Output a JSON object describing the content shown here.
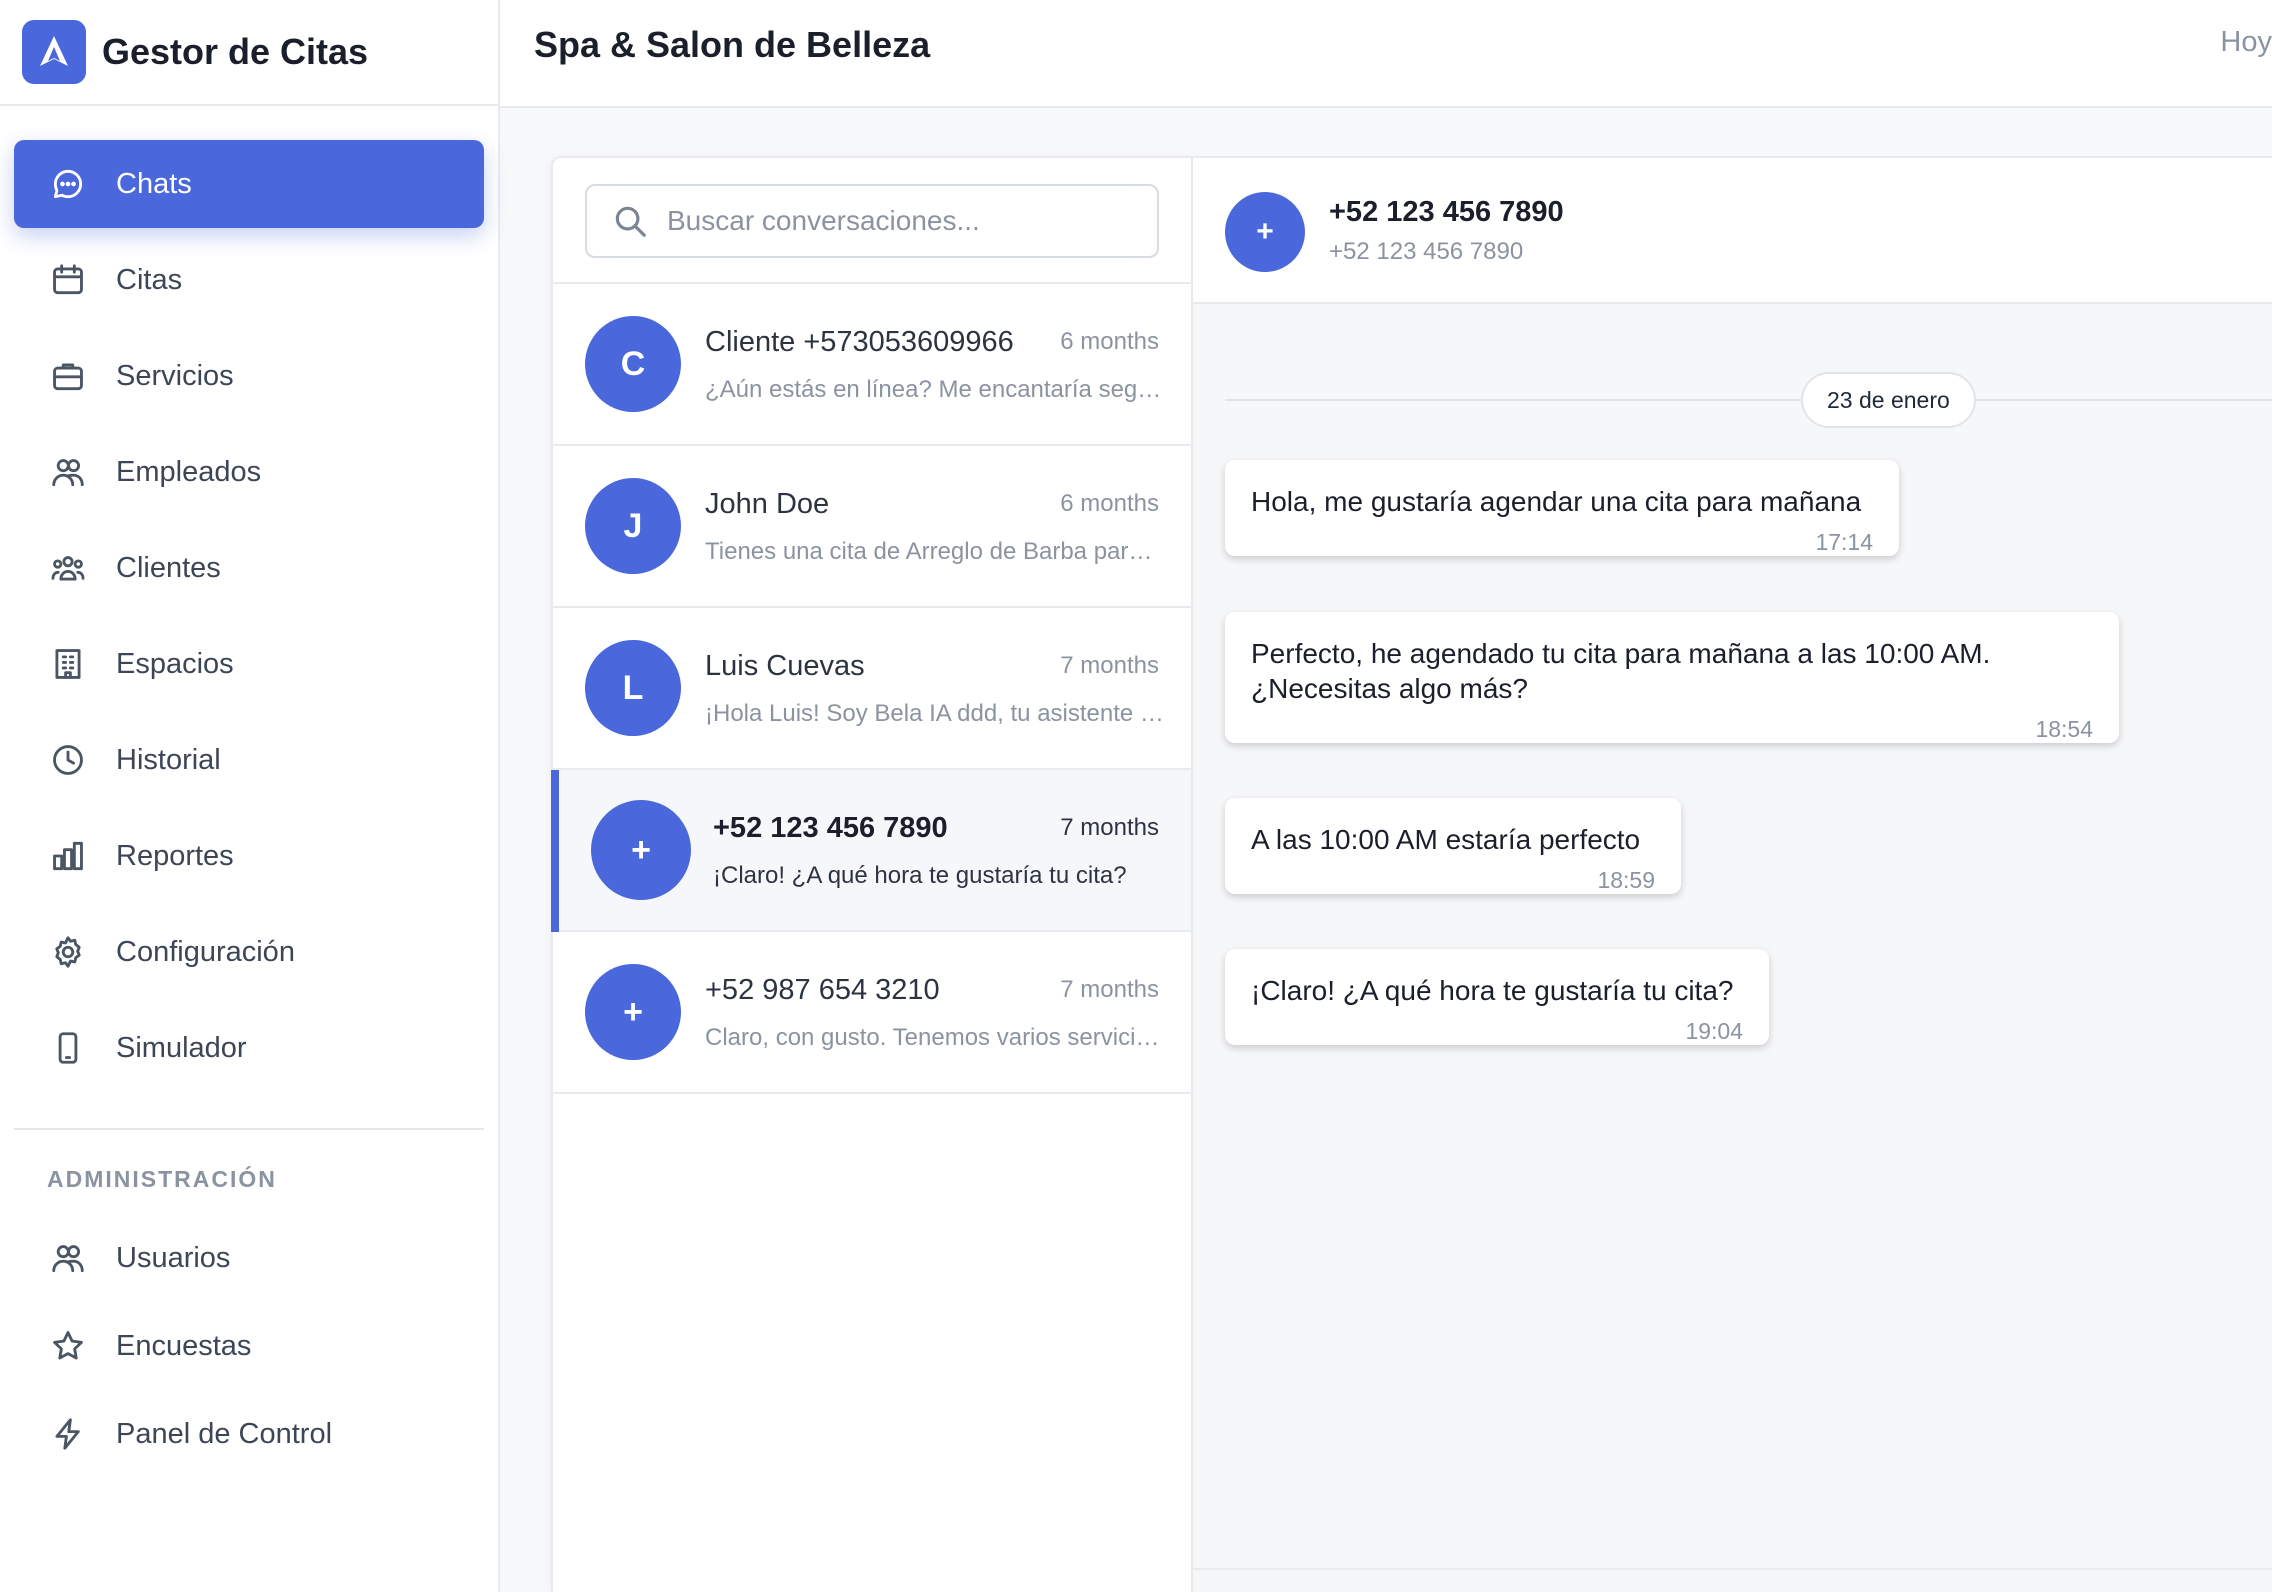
{
  "app": {
    "title": "Gestor de Citas"
  },
  "header": {
    "title": "Spa & Salon de Belleza",
    "right_text": "Hoy"
  },
  "sidebar": {
    "items": [
      {
        "label": "Chats",
        "icon": "chat-bubble-icon",
        "active": true
      },
      {
        "label": "Citas",
        "icon": "calendar-icon"
      },
      {
        "label": "Servicios",
        "icon": "briefcase-icon"
      },
      {
        "label": "Empleados",
        "icon": "users-icon"
      },
      {
        "label": "Clientes",
        "icon": "user-group-icon"
      },
      {
        "label": "Espacios",
        "icon": "building-icon"
      },
      {
        "label": "Historial",
        "icon": "clock-icon"
      },
      {
        "label": "Reportes",
        "icon": "bar-chart-icon"
      },
      {
        "label": "Configuración",
        "icon": "gear-icon"
      },
      {
        "label": "Simulador",
        "icon": "phone-icon"
      }
    ],
    "admin_title": "ADMINISTRACIÓN",
    "admin_items": [
      {
        "label": "Usuarios",
        "icon": "users-icon"
      },
      {
        "label": "Encuestas",
        "icon": "star-icon"
      },
      {
        "label": "Panel de Control",
        "icon": "lightning-icon"
      }
    ]
  },
  "search": {
    "placeholder": "Buscar conversaciones..."
  },
  "conversations": [
    {
      "initial": "C",
      "name": "Cliente +573053609966",
      "time": "6 months",
      "preview": "¿Aún estás en línea? Me encantaría seguir ayudándote"
    },
    {
      "initial": "J",
      "name": "John Doe",
      "time": "6 months",
      "preview": "Tienes una cita de Arreglo de Barba para mañana"
    },
    {
      "initial": "L",
      "name": "Luis Cuevas",
      "time": "7 months",
      "preview": "¡Hola Luis! Soy Bela IA ddd, tu asistente virtual"
    },
    {
      "initial": "+",
      "name": "+52 123 456 7890",
      "time": "7 months",
      "preview": "¡Claro! ¿A qué hora te gustaría tu cita?",
      "active": true
    },
    {
      "initial": "+",
      "name": "+52 987 654 3210",
      "time": "7 months",
      "preview": "Claro, con gusto. Tenemos varios servicios disponibles"
    }
  ],
  "chat": {
    "avatar": "+",
    "name": "+52 123 456 7890",
    "subtitle": "+52 123 456 7890",
    "date_label": "23 de enero",
    "messages": [
      {
        "text": "Hola, me gustaría agendar una cita para mañana",
        "time": "17:14"
      },
      {
        "text": "Perfecto, he agendado tu cita para mañana a las 10:00 AM. ¿Necesitas algo más?",
        "time": "18:54"
      },
      {
        "text": "A las 10:00 AM estaría perfecto",
        "time": "18:59"
      },
      {
        "text": "¡Claro! ¿A qué hora te gustaría tu cita?",
        "time": "19:04"
      }
    ]
  },
  "colors": {
    "accent": "#4a67dc"
  }
}
